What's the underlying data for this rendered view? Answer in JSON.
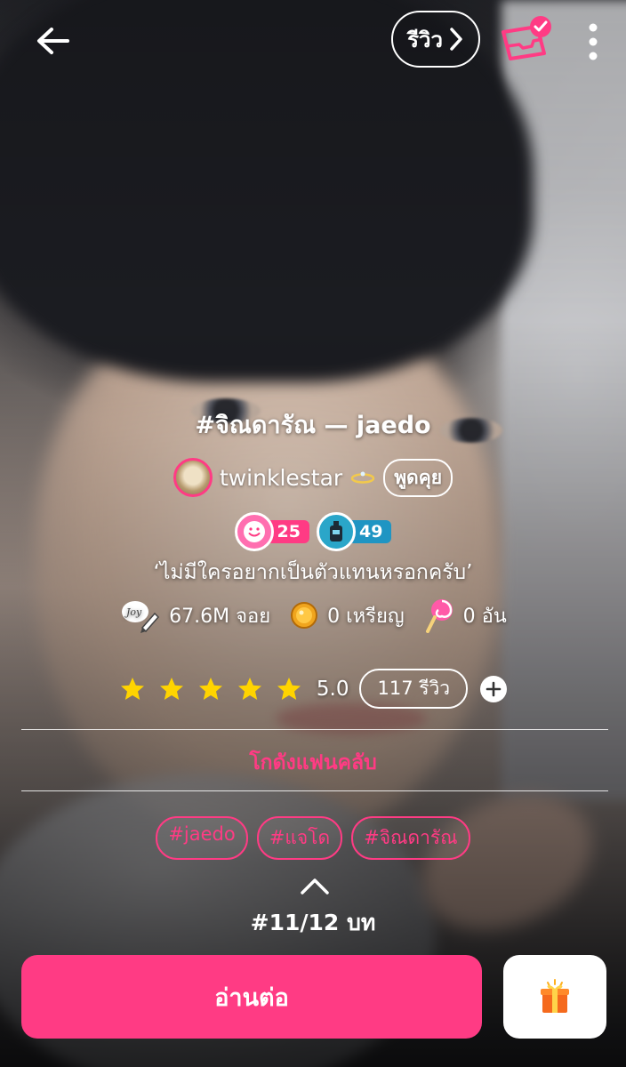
{
  "header": {
    "review_label": "รีวิว"
  },
  "story": {
    "title": "#จิณดารัณ — jaedo",
    "author": "twinklestar",
    "chat_label": "พูดคุย",
    "badges": [
      {
        "value": "25",
        "color": "#ff3b84"
      },
      {
        "value": "49",
        "color": "#1f95c3"
      }
    ],
    "tagline": "‘ไม่มีใครอยากเป็นตัวแทนหรอกครับ’",
    "stats": {
      "views": "67.6M จอย",
      "coins": "0 เหรียญ",
      "candies": "0 อัน"
    },
    "rating": {
      "stars": 5,
      "score": "5.0",
      "reviews": "117 รีวิว"
    },
    "fanclub_label": "โกดังแฟนคลับ",
    "tags": [
      "#jaedo",
      "#แจโด",
      "#จิณดารัณ"
    ],
    "episode": "#11/12 บท"
  },
  "footer": {
    "read_label": "อ่านต่อ"
  },
  "colors": {
    "accent": "#ff3b84",
    "badge_blue": "#1f95c3"
  }
}
